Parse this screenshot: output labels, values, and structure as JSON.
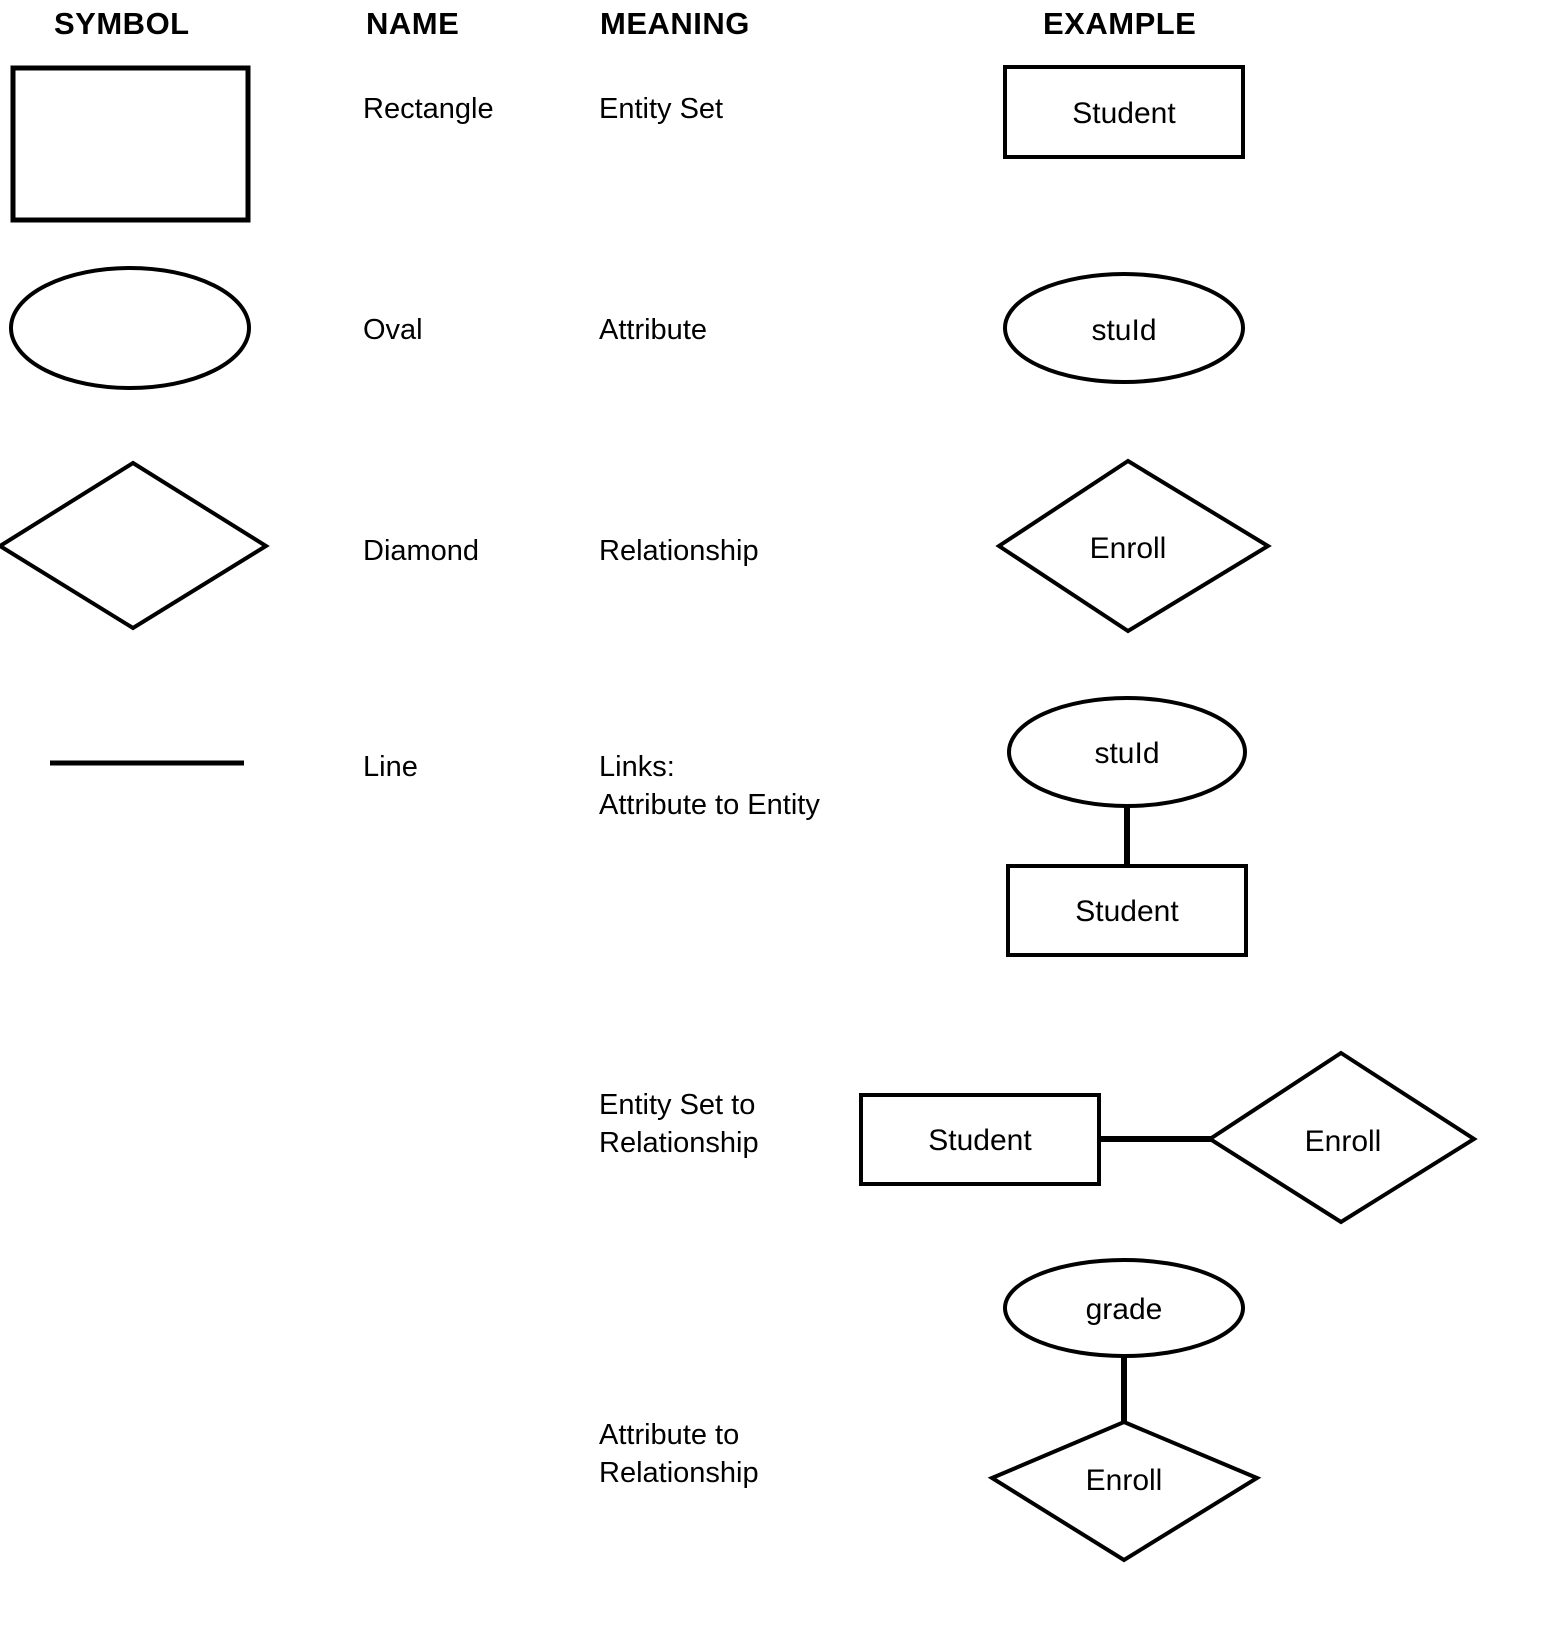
{
  "page": {
    "title": "ER Diagram Notation Reference",
    "background": "#ffffff",
    "ink": "#000000"
  },
  "headers": {
    "symbol": "SYMBOL",
    "name": "NAME",
    "meaning": "MEANING",
    "example": "EXAMPLE"
  },
  "rows": [
    {
      "id": "rectangle",
      "name": "Rectangle",
      "meaning": "Entity Set",
      "symbol_shape": "rectangle",
      "example_labels": [
        "Student"
      ]
    },
    {
      "id": "oval",
      "name": "Oval",
      "meaning": "Attribute",
      "symbol_shape": "oval",
      "example_labels": [
        "stuId"
      ]
    },
    {
      "id": "diamond",
      "name": "Diamond",
      "meaning": "Relationship",
      "symbol_shape": "diamond",
      "example_labels": [
        "Enroll"
      ]
    },
    {
      "id": "line-attribute-entity",
      "name": "Line",
      "meaning": "Links:\nAttribute to Entity",
      "symbol_shape": "line",
      "example_labels": [
        "stuId",
        "Student"
      ]
    },
    {
      "id": "line-entityset-relationship",
      "name": "",
      "meaning": "Entity Set to\nRelationship",
      "symbol_shape": "",
      "example_labels": [
        "Student",
        "Enroll"
      ]
    },
    {
      "id": "line-attribute-relationship",
      "name": "",
      "meaning": "Attribute to\nRelationship",
      "symbol_shape": "",
      "example_labels": [
        "grade",
        "Enroll"
      ]
    }
  ],
  "shape_labels": {
    "student": "Student",
    "stu_id": "stuId",
    "enroll": "Enroll",
    "grade": "grade"
  }
}
